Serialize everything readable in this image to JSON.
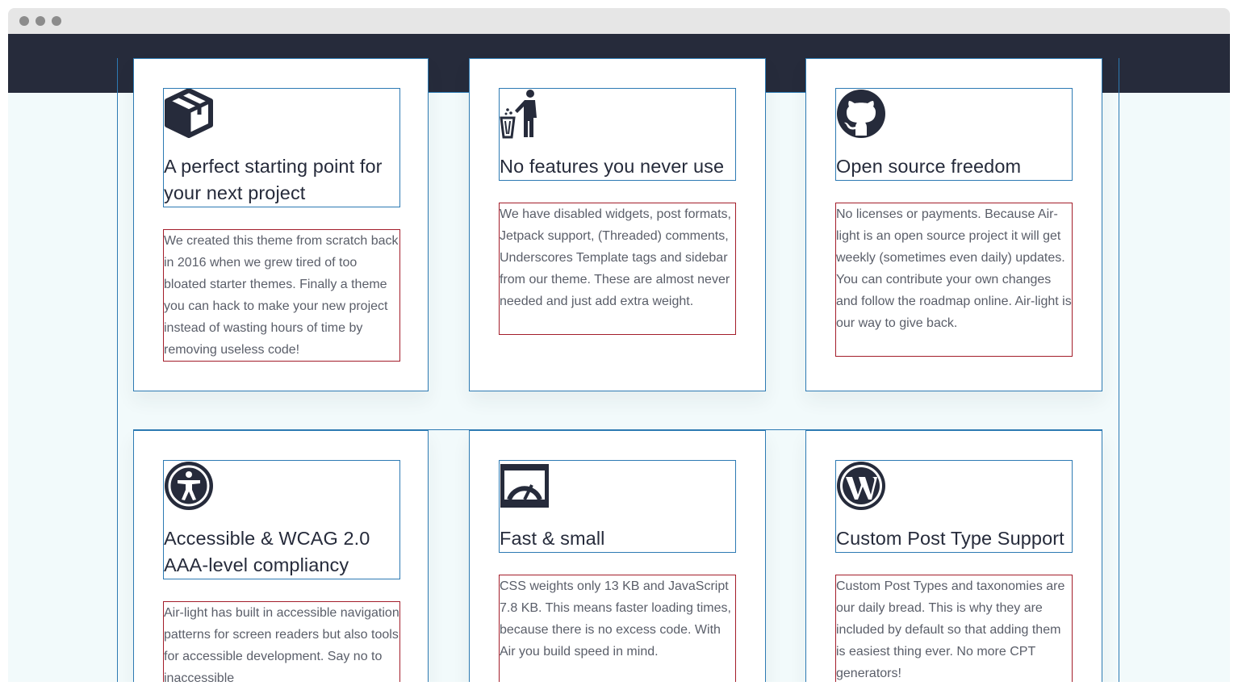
{
  "window": {
    "controls": [
      "close-dot",
      "minimize-dot",
      "maximize-dot"
    ]
  },
  "cards": [
    {
      "icon": "package-icon",
      "title": "A perfect starting point for your next project",
      "description": "We created this theme from scratch back in 2016 when we grew tired of too bloated starter themes. Finally a theme you can hack to make your new project instead of wasting hours of time by removing useless code!"
    },
    {
      "icon": "trash-person-icon",
      "title": "No features you never use",
      "description": "We have disabled widgets, post formats, Jetpack support, (Threaded) comments, Underscores Template tags and sidebar from our theme. These are almost never needed and just add extra weight."
    },
    {
      "icon": "github-icon",
      "title": "Open source freedom",
      "description": "No licenses or payments. Because Air-light is an open source project it will get weekly (sometimes even daily) updates. You can contribute your own changes and follow the roadmap online. Air-light is our way to give back."
    },
    {
      "icon": "accessibility-icon",
      "title": "Accessible & WCAG 2.0 AAA-level compliancy",
      "description": "Air-light has built in accessible navigation patterns for screen readers but also tools for accessible development. Say no to inaccessible"
    },
    {
      "icon": "speedometer-icon",
      "title": "Fast & small",
      "description": "CSS weights only 13 KB and JavaScript 7.8 KB. This means faster loading times, because there is no excess code. With Air you build speed in mind."
    },
    {
      "icon": "wordpress-icon",
      "title": "Custom Post Type Support",
      "description": "Custom Post Types and taxonomies are our daily bread. This is why they are included by default so that adding them is easiest thing ever. No more CPT generators!"
    }
  ],
  "colors": {
    "dark": "#262b3b",
    "text": "#5a5e69",
    "outline_blue": "#2d7ab3",
    "outline_red": "#a31d2a",
    "background": "#f2fafb"
  }
}
